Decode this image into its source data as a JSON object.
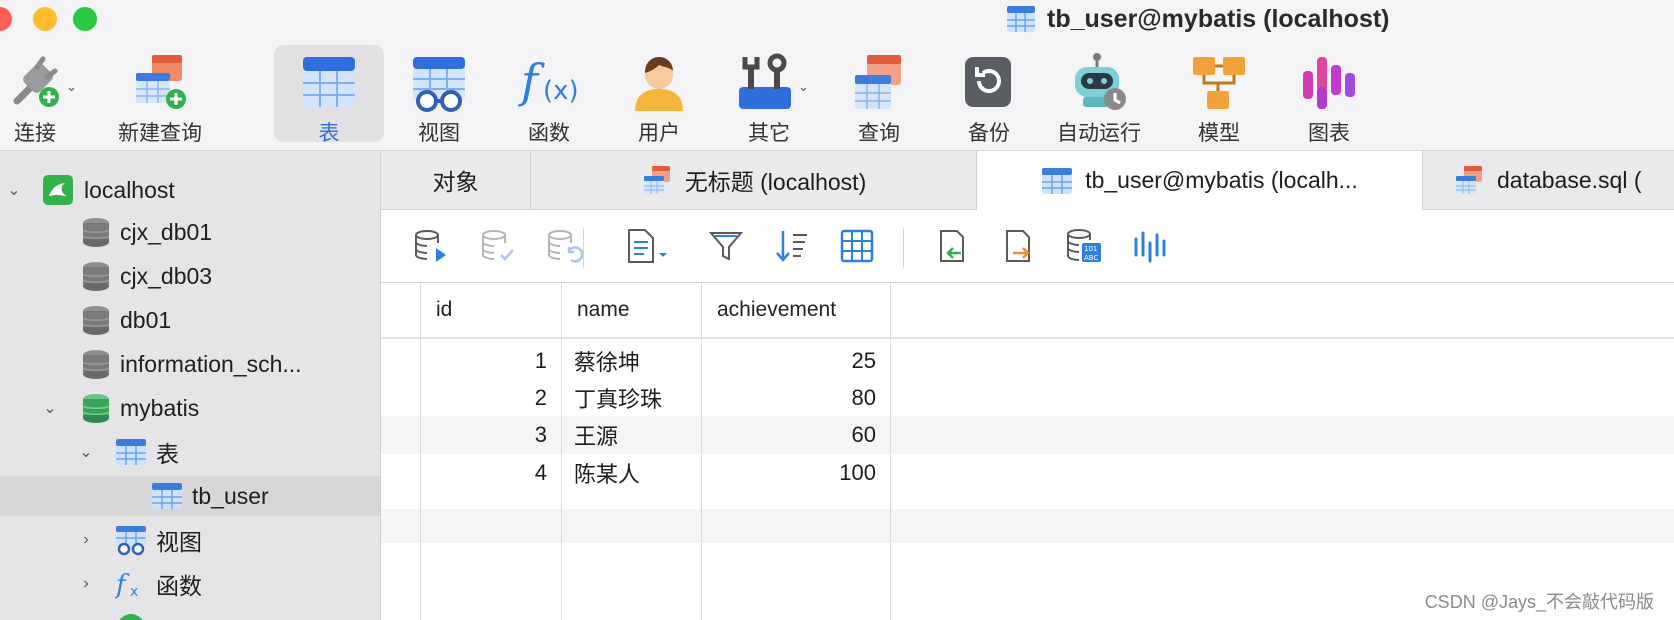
{
  "window": {
    "title": "tb_user@mybatis (localhost)"
  },
  "toolbar": {
    "connect": "连接",
    "new_query": "新建查询",
    "table": "表",
    "view": "视图",
    "function": "函数",
    "user": "用户",
    "other": "其它",
    "query": "查询",
    "backup": "备份",
    "automation": "自动运行",
    "model": "模型",
    "chart": "图表"
  },
  "sidebar": {
    "connection": "localhost",
    "databases": [
      "cjx_db01",
      "cjx_db03",
      "db01",
      "information_sch...",
      "mybatis"
    ],
    "mybatis_children": {
      "tables_label": "表",
      "table_item": "tb_user",
      "views_label": "视图",
      "functions_label": "函数"
    }
  },
  "tabs": [
    {
      "label": "对象"
    },
    {
      "label": "无标题 (localhost)"
    },
    {
      "label": "tb_user@mybatis (localh..."
    },
    {
      "label": "database.sql ("
    }
  ],
  "grid": {
    "columns": [
      "id",
      "name",
      "achievement"
    ],
    "rows": [
      {
        "id": "1",
        "name": "蔡徐坤",
        "achievement": "25"
      },
      {
        "id": "2",
        "name": "丁真珍珠",
        "achievement": "80"
      },
      {
        "id": "3",
        "name": "王源",
        "achievement": "60"
      },
      {
        "id": "4",
        "name": "陈某人",
        "achievement": "100"
      }
    ]
  },
  "watermark": "CSDN @Jays_不会敲代码版",
  "colors": {
    "accent": "#2f6fdc",
    "table_blue": "#3b7ddd",
    "db_grey": "#7b7b7d",
    "db_green": "#3aa35a",
    "selection": "#d7d7da"
  }
}
